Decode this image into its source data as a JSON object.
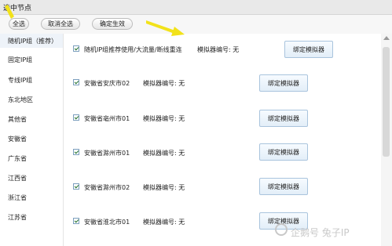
{
  "window": {
    "title": "选中节点"
  },
  "toolbar": {
    "select_all": "全选",
    "deselect_all": "取消全选",
    "confirm": "确定生效"
  },
  "sidebar": {
    "items": [
      {
        "label": "随机IP组（推荐）",
        "active": true
      },
      {
        "label": "固定IP组"
      },
      {
        "label": "专线IP组"
      },
      {
        "label": "东北地区"
      },
      {
        "label": "其他省"
      },
      {
        "label": "安徽省"
      },
      {
        "label": "广东省"
      },
      {
        "label": "江西省"
      },
      {
        "label": "浙江省"
      },
      {
        "label": "江苏省"
      }
    ]
  },
  "main": {
    "rows": [
      {
        "checked": true,
        "name": "随机IP组推荐使用/大流量/断线重连",
        "emulator": "模拟器编号: 无",
        "button": "绑定模拟器"
      },
      {
        "checked": true,
        "name": "安徽省安庆市02",
        "emulator": "模拟器编号: 无",
        "button": "绑定模拟器"
      },
      {
        "checked": true,
        "name": "安徽省亳州市01",
        "emulator": "模拟器编号: 无",
        "button": "绑定模拟器"
      },
      {
        "checked": true,
        "name": "安徽省滁州市01",
        "emulator": "模拟器编号: 无",
        "button": "绑定模拟器"
      },
      {
        "checked": true,
        "name": "安徽省滁州市02",
        "emulator": "模拟器编号: 无",
        "button": "绑定模拟器"
      },
      {
        "checked": true,
        "name": "安徽省淮北市01",
        "emulator": "模拟器编号: 无",
        "button": "绑定模拟器"
      }
    ]
  },
  "watermark": {
    "text": "企鹅号 兔子IP"
  },
  "colors": {
    "accent_button": "#e3eef8",
    "checkbox_border": "#7b9ebd",
    "sidebar_active": "#eef3f9"
  }
}
